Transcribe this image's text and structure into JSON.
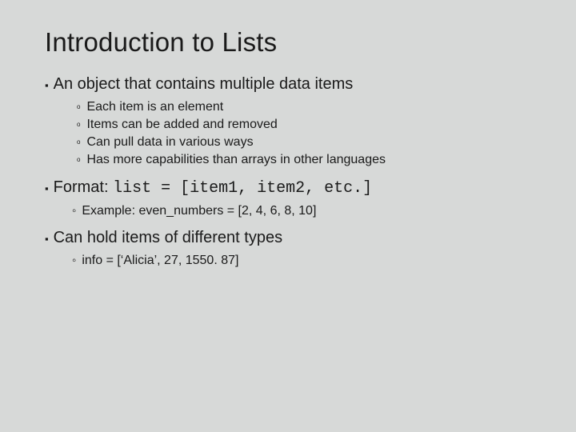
{
  "title": "Introduction to Lists",
  "sections": [
    {
      "heading": "An object that contains multiple data items",
      "style": "square",
      "subs": [
        {
          "text": "Each item is an element"
        },
        {
          "text": "Items can be added and removed"
        },
        {
          "text": "Can pull data in various ways"
        },
        {
          "text": "Has more capabilities than arrays in other languages"
        }
      ]
    },
    {
      "heading_prefix": "Format: ",
      "heading_code": "list = [item1, item2, etc.]",
      "style": "square",
      "sub_style": "ring",
      "subs": [
        {
          "text": "Example: even_numbers = [2, 4, 6, 8, 10]"
        }
      ]
    },
    {
      "heading": "Can hold items of different types",
      "style": "square",
      "sub_style": "ring",
      "subs": [
        {
          "text": "info = [‘Alicia’, 27, 1550. 87]"
        }
      ]
    }
  ]
}
